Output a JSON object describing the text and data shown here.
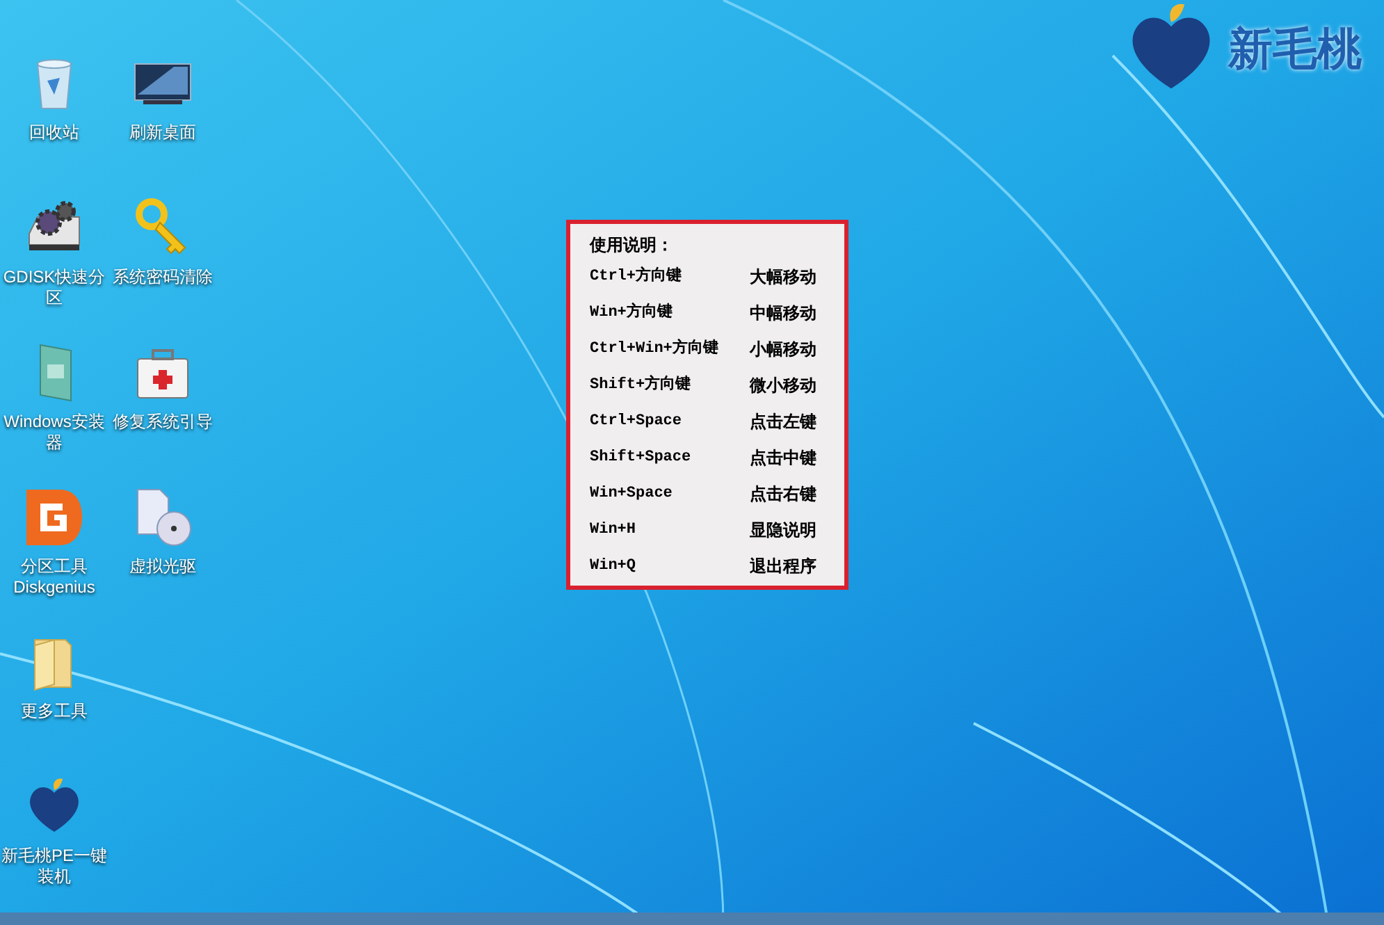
{
  "desktop_icon_rows": [
    {
      "icons": [
        {
          "kind": "recycle",
          "label": "回收站"
        },
        {
          "kind": "monitor",
          "label": "刷新桌面"
        }
      ]
    },
    {
      "icons": [
        {
          "kind": "gears",
          "label": "GDISK快速分区"
        },
        {
          "kind": "key",
          "label": "系统密码清除"
        }
      ]
    },
    {
      "icons": [
        {
          "kind": "installer",
          "label": "Windows安装器"
        },
        {
          "kind": "firstaid",
          "label": "修复系统引导"
        }
      ]
    },
    {
      "icons": [
        {
          "kind": "diskgenius",
          "label": "分区工具Diskgenius"
        },
        {
          "kind": "cd",
          "label": "虚拟光驱"
        }
      ]
    },
    {
      "icons": [
        {
          "kind": "folder",
          "label": "更多工具"
        }
      ]
    },
    {
      "icons": [
        {
          "kind": "peach",
          "label": "新毛桃PE一键装机"
        }
      ]
    }
  ],
  "logo": {
    "text": "新毛桃"
  },
  "help_popup": {
    "title": "使用说明：",
    "rows": [
      {
        "keys": "Ctrl+方向键",
        "action": "大幅移动"
      },
      {
        "keys": "Win+方向键",
        "action": "中幅移动"
      },
      {
        "keys": "Ctrl+Win+方向键",
        "action": "小幅移动"
      },
      {
        "keys": "Shift+方向键",
        "action": "微小移动"
      },
      {
        "keys": "Ctrl+Space",
        "action": "点击左键"
      },
      {
        "keys": "Shift+Space",
        "action": "点击中键"
      },
      {
        "keys": "Win+Space",
        "action": "点击右键"
      },
      {
        "keys": "Win+H",
        "action": "显隐说明"
      },
      {
        "keys": "Win+Q",
        "action": "退出程序"
      }
    ]
  }
}
